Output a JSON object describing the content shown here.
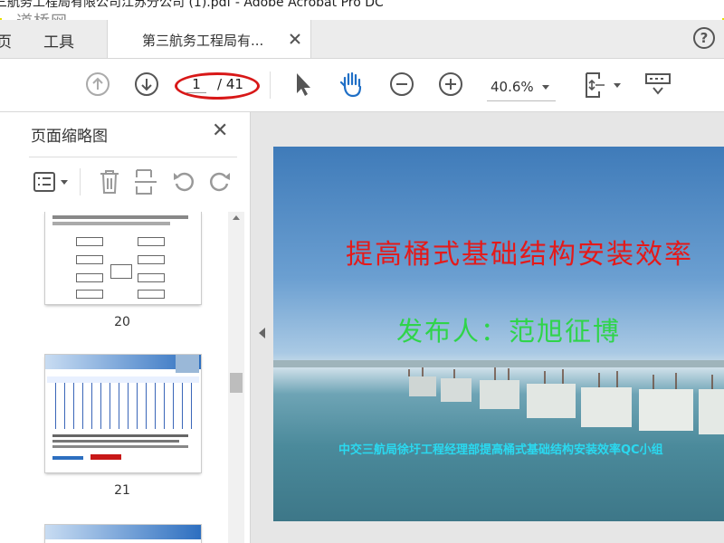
{
  "window": {
    "title": "三航务工程局有限公司江苏分公司 (1).pdf - Adobe Acrobat Pro DC",
    "watermark": "道桥网"
  },
  "tabs": {
    "home_label": "页",
    "tools_label": "工具",
    "document_label": "第三航务工程局有..."
  },
  "toolbar": {
    "current_page": "1",
    "total_pages": "/ 41",
    "zoom_level": "40.6%"
  },
  "sidebar": {
    "title": "页面缩略图",
    "thumbnails": [
      {
        "page_label": "20"
      },
      {
        "page_label": "21"
      }
    ]
  },
  "slide": {
    "title": "提高桶式基础结构安装效率",
    "publisher": "发布人：范旭征博",
    "footer": "中交三航局徐圩工程经理部提高桶式基础结构安装效率QC小组"
  },
  "colors": {
    "highlight_border": "#e8e000",
    "annotation_red": "#d81818",
    "slide_title": "#e41a1a",
    "slide_publisher": "#2fd44a",
    "slide_footer": "#2ad9f0"
  }
}
